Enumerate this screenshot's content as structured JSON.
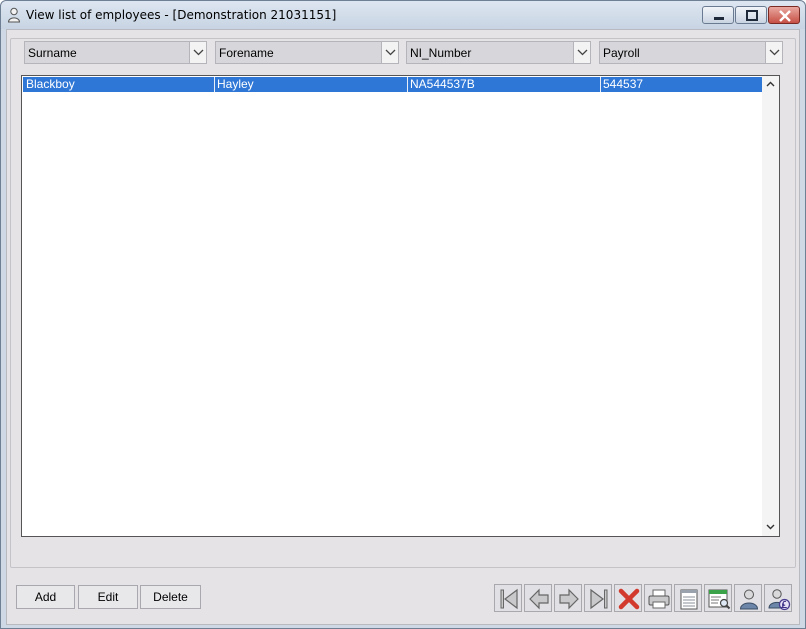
{
  "window": {
    "title": "View list of employees - [Demonstration 21031151]"
  },
  "filters": [
    {
      "label": "Surname"
    },
    {
      "label": "Forename"
    },
    {
      "label": "NI_Number"
    },
    {
      "label": "Payroll"
    }
  ],
  "list": {
    "rows": [
      {
        "surname": "Blackboy",
        "forename": "Hayley",
        "ni_number": "NA544537B",
        "payroll": "544537",
        "selected": true
      }
    ]
  },
  "buttons": {
    "add": "Add",
    "edit": "Edit",
    "delete": "Delete"
  },
  "toolbar_icons": [
    "first-record-icon",
    "previous-record-icon",
    "next-record-icon",
    "last-record-icon",
    "cancel-icon",
    "print-icon",
    "notepad-icon",
    "report-preview-icon",
    "employee-icon",
    "employee-pay-icon"
  ],
  "colors": {
    "selection": "#2f77d6",
    "cancel_red": "#d23a2e"
  }
}
